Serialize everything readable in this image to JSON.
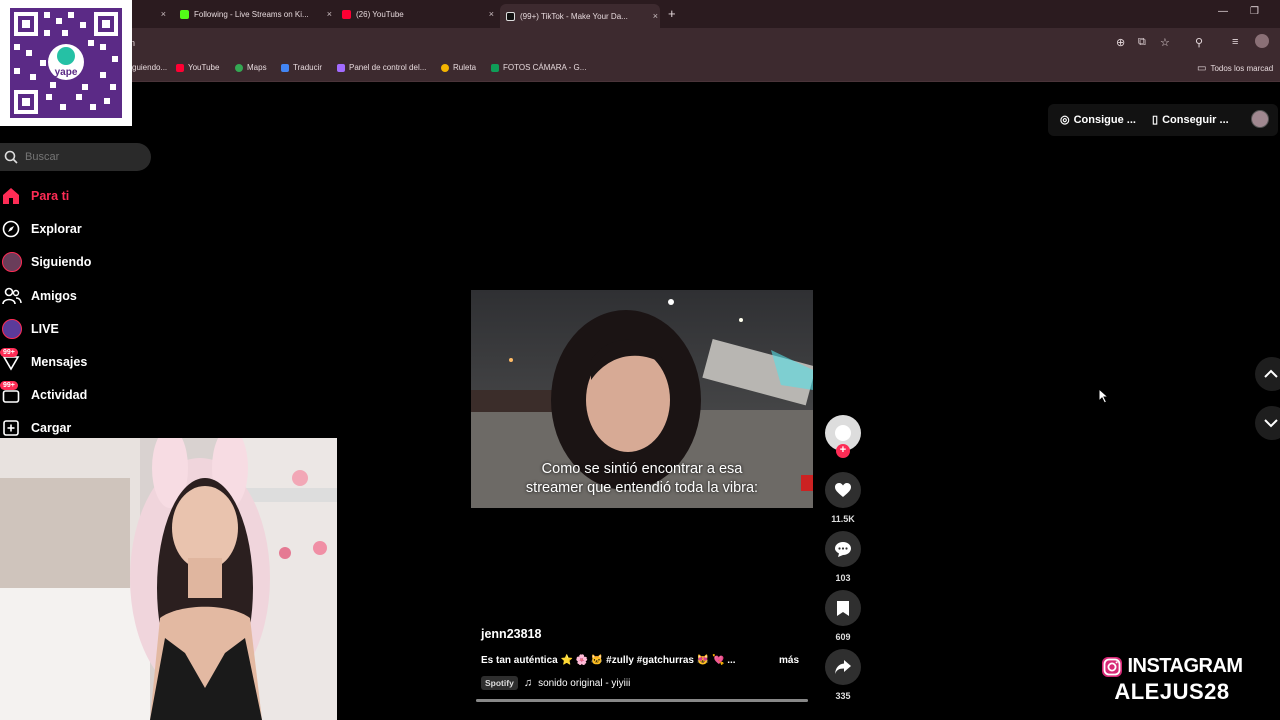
{
  "browser": {
    "tabs": [
      {
        "label": "",
        "close": "×"
      },
      {
        "label": "Following - Live Streams on Ki...",
        "close": "×"
      },
      {
        "label": "(26) YouTube",
        "close": "×"
      },
      {
        "label": "(99+) TikTok - Make Your Da...",
        "close": "×"
      }
    ],
    "new_tab": "+",
    "address_fragment": "n",
    "bookmarks": [
      {
        "label": "guiendo..."
      },
      {
        "label": "YouTube"
      },
      {
        "label": "Maps"
      },
      {
        "label": "Traducir"
      },
      {
        "label": "Panel de control del..."
      },
      {
        "label": "Ruleta"
      },
      {
        "label": "FOTOS CÁMARA - G..."
      }
    ],
    "all_bookmarks": "Todos los marcad"
  },
  "qr": {
    "brand": "yape"
  },
  "header": {
    "get_coins": "Consigue ...",
    "get_app": "Conseguir ..."
  },
  "search": {
    "placeholder": "Buscar"
  },
  "nav": {
    "items": [
      {
        "label": "Para ti"
      },
      {
        "label": "Explorar"
      },
      {
        "label": "Siguiendo"
      },
      {
        "label": "Amigos"
      },
      {
        "label": "LIVE"
      },
      {
        "label": "Mensajes",
        "badge": "99+"
      },
      {
        "label": "Actividad",
        "badge": "99+"
      },
      {
        "label": "Cargar"
      }
    ]
  },
  "video": {
    "caption_line1": "Como se sintió encontrar a esa",
    "caption_line2": "streamer que entendió toda la vibra:",
    "author": "jenn23818",
    "description": "Es tan auténtica ⭐ 🌸 🐱 #zully #gatchurras 😻 💘 ...",
    "more": "más",
    "spotify_label": "Spotify",
    "sound": "sonido original - yiyiii",
    "progress": 1.0
  },
  "actions": {
    "likes": "11.5K",
    "comments": "103",
    "saves": "609",
    "shares": "335"
  },
  "overlay": {
    "instagram_label": "INSTAGRAM",
    "handle": "ALEJUS28"
  },
  "colors": {
    "accent": "#fe2c55",
    "chrome": "#3d2a2f"
  }
}
